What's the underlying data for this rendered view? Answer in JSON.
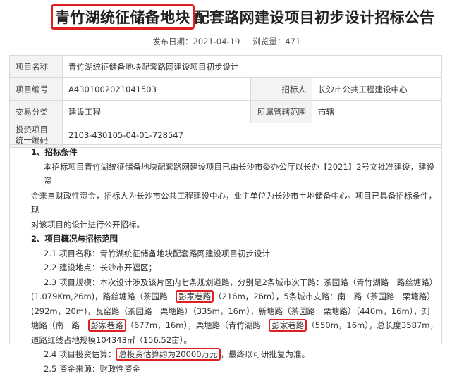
{
  "title": {
    "highlighted": "青竹湖统征储备地块",
    "rest": "配套路网建设项目初步设计招标公告"
  },
  "meta": {
    "publish_label": "发布日期：",
    "publish_date": "2021-04-19",
    "views_label": "浏览量：",
    "views": "471"
  },
  "info": {
    "project_name_label": "项目名称",
    "project_name": "青竹湖统征储备地块配套路网建设项目初步设计",
    "project_no_label": "项目编号",
    "project_no": "A4301002021041503",
    "tenderer_label": "招标人",
    "tenderer": "长沙市公共工程建设中心",
    "trade_label": "交易分类",
    "trade": "建设工程",
    "region_label": "所属管辖范围",
    "region": "市辖",
    "invest_label_1": "投资项目",
    "invest_label_2": "统一编码",
    "invest_code": "2103-430105-04-01-728547"
  },
  "content": {
    "s1_title": "1、招标条件",
    "s1_l1": "本招标项目青竹湖统征储备地块配套路网建设项目已由长沙市委办公厅以长办【2021】2号文批准建设，建设资",
    "s1_l2": "金来自财政性资金，招标人为长沙市公共工程建设中心，业主单位为长沙市土地储备中心。项目已具备招标条件，现",
    "s1_l3": "对该项目的设计进行公开招标。",
    "s2_title": "2、项目概况与招标范围",
    "s2_1": "2.1 项目名称：青竹湖统征储备地块配套路网建设项目初步设计",
    "s2_2": "2.2 建设地点：长沙市开福区；",
    "s2_3_l1": "2.3 项目规模：本次设计涉及该片区内七条规划道路，分别是2条城市次干路：茶园路（青竹湖路一路丝塘路）",
    "s2_3_l2a": "(1.079Km,26m)，路丝塘路（茶园路一",
    "s2_3_l2b": "彭家巷路",
    "s2_3_l2c": "（216m，26m），5条城市支路：南一路（茶园路一栗塘路）",
    "s2_3_l3": "(292m，20m)，瓦窑路（茶园路一栗塘路）（335m，16m），新塘路（茶园路一栗塘路）（440m，16m），刘",
    "s2_3_l4a": "塘路（南一路一",
    "s2_3_l4b": "彭家巷路",
    "s2_3_l4c": "（677m，16m），栗塘路（青竹湖路一",
    "s2_3_l4d": "彭家巷路",
    "s2_3_l4e": "（550m，16m），总长度3587m，",
    "s2_3_l5": "道路红线占地规模104343㎡（156.52亩）。",
    "s2_4a": "2.4 项目投资估算：",
    "s2_4b": "总投资估算约为20000万元",
    "s2_4c": "，最终以可研批复为准。",
    "s2_5": "2.5 资金来源：财政性资金"
  }
}
